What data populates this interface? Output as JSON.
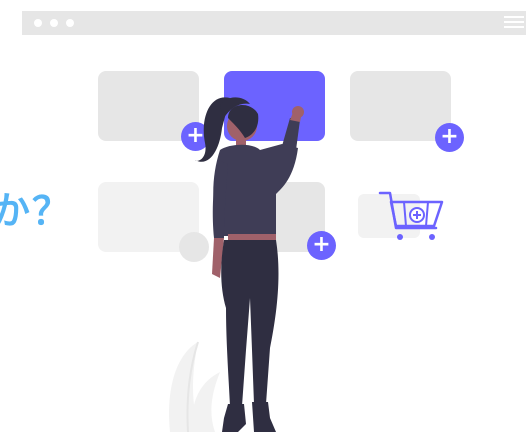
{
  "browser": {
    "dots": 3,
    "menu_icon": "hamburger-icon",
    "bar_color": "#e6e6e6"
  },
  "cards": [
    {
      "id": "card-top-left",
      "state": "default"
    },
    {
      "id": "card-top-center",
      "state": "selected"
    },
    {
      "id": "card-top-right",
      "state": "default"
    },
    {
      "id": "card-bottom-left",
      "state": "default"
    },
    {
      "id": "card-bottom-center",
      "state": "default"
    },
    {
      "id": "card-bottom-right",
      "state": "cart"
    }
  ],
  "add_buttons": {
    "label": "+",
    "icon": "plus-icon"
  },
  "side_text": "か？",
  "icons": {
    "cart": "shopping-cart-icon",
    "person": "woman-figure-illustration",
    "plant": "plant-illustration"
  },
  "colors": {
    "accent": "#6c63ff",
    "card_gray": "#e6e6e6",
    "card_light": "#f2f2f2",
    "text_blue": "#55b4f5",
    "figure_dark": "#2f2e41",
    "figure_top": "#3f3d56",
    "skin": "#a0616a"
  }
}
